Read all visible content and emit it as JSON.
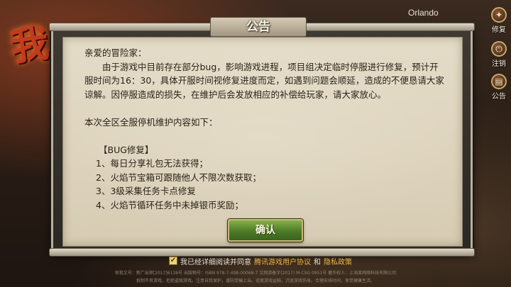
{
  "top_bar": {
    "player_name": "Orlando"
  },
  "side_menu": [
    {
      "label": "修复",
      "icon": "wrench-icon",
      "glyph": "✦"
    },
    {
      "label": "注销",
      "icon": "logout-icon",
      "glyph": "⏻"
    },
    {
      "label": "公告",
      "icon": "notice-icon",
      "glyph": "▤"
    }
  ],
  "notice": {
    "title": "公告",
    "greeting": "亲爱的冒险家：",
    "paragraph": "由于游戏中目前存在部分bug，影响游戏进程，项目组决定临时停服进行修复，预计开服时间为16：30，具体开服时间视修复进度而定，如遇到问题会顺延，造成的不便恳请大家谅解。因停服造成的损失，在维护后会发放相应的补偿给玩家，请大家放心。",
    "maintenance_heading": "本次全区全服停机维护内容如下：",
    "bug_section_title": "【BUG修复】",
    "bug_items": [
      "1、每日分享礼包无法获得；",
      "2、火焰节宝箱可跟随他人不限次数获取；",
      "3、3级采集任务卡点修复",
      "4、火焰节循环任务中未掉银币奖励；"
    ],
    "confirm_label": "确认"
  },
  "footer": {
    "agree_prefix": "我已经详细阅读并同意",
    "agree_link1": "腾讯游戏用户协议",
    "agree_and": "和",
    "agree_link2": "隐私政策",
    "legal_line1": "审批文号：新广出审[2017]6138号 出版物号：ISBN 978-7-498-00068-7 文网游备字(2017) M-CSG 0951号 著作权人：上海某网络科技有限公司",
    "legal_line2": "抵制不良游戏，拒绝盗版游戏。注意自我保护，谨防受骗上当。适度游戏益脑，沉迷游戏伤身。合理安排时间，享受健康生活。"
  }
}
